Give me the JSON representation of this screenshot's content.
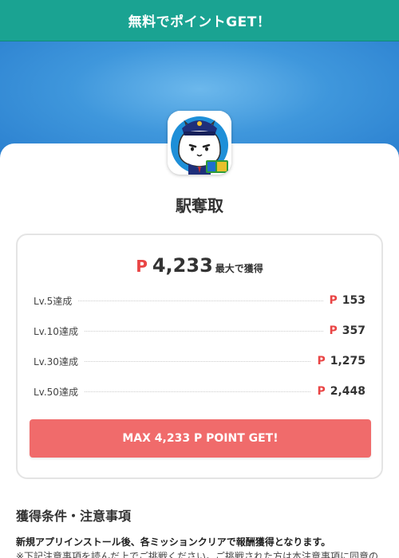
{
  "header": {
    "title": "無料でポイントGET！"
  },
  "app": {
    "name": "駅奪取"
  },
  "reward": {
    "currency_mark": "P",
    "max_value": "4,233",
    "max_suffix": "最大で獲得",
    "levels": [
      {
        "label": "Lv.5達成",
        "points": "153"
      },
      {
        "label": "Lv.10達成",
        "points": "357"
      },
      {
        "label": "Lv.30達成",
        "points": "1,275"
      },
      {
        "label": "Lv.50達成",
        "points": "2,448"
      }
    ],
    "button_label": "MAX 4,233 P POINT GET!"
  },
  "conditions": {
    "title": "獲得条件・注意事項",
    "line1": "新規アプリインストール後、各ミッションクリアで報酬獲得となります。",
    "line2": "※下記注意事項を読んだ上でご挑戦ください。ご挑戦された方は本注意事項に同意の"
  },
  "colors": {
    "header_bg": "#1aa392",
    "accent_red": "#e94545",
    "button_bg": "#f06b6b",
    "hero_blue": "#3f97dc"
  },
  "icons": [
    "app-icon-cat-police"
  ]
}
